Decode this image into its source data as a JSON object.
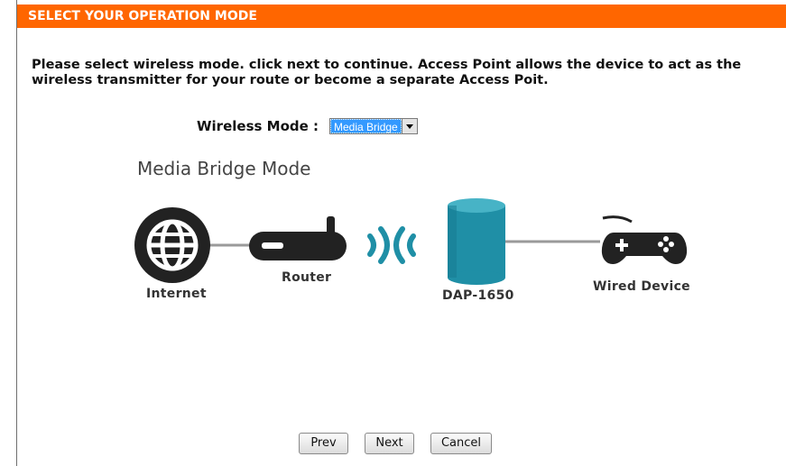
{
  "header": {
    "title": "SELECT YOUR OPERATION MODE"
  },
  "description": "Please select wireless mode. click next to continue. Access Point allows the device to act as the wireless transmitter for your route or become a separate Access Poit.",
  "wireless_mode": {
    "label": "Wireless Mode :",
    "selected": "Media Bridge"
  },
  "diagram": {
    "title": "Media Bridge Mode",
    "internet_label": "Internet",
    "router_label": "Router",
    "device_label": "DAP-1650",
    "wired_label": "Wired Device",
    "colors": {
      "dark": "#222222",
      "teal": "#1f8fa6",
      "line": "#999999"
    },
    "icons": [
      "globe-icon",
      "router-icon",
      "wifi-signal-icon",
      "access-point-icon",
      "gamepad-icon"
    ]
  },
  "buttons": {
    "prev": "Prev",
    "next": "Next",
    "cancel": "Cancel"
  },
  "colors": {
    "header_bg": "#ff6600",
    "select_highlight": "#3399ff"
  }
}
